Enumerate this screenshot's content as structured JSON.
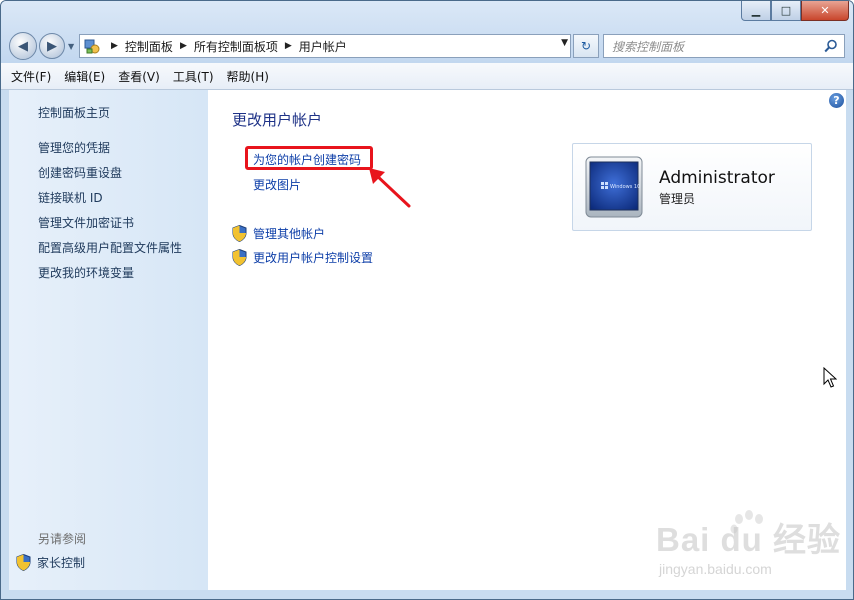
{
  "window": {
    "minimize": "▁",
    "maximize": "□",
    "close": "✕"
  },
  "nav": {
    "back_glyph": "◀",
    "forward_glyph": "▶",
    "recent_glyph": "▼"
  },
  "address": {
    "crumbs": [
      "控制面板",
      "所有控制面板项",
      "用户帐户"
    ],
    "drop_glyph": "▼",
    "refresh_glyph": "↻"
  },
  "search": {
    "placeholder": "搜索控制面板"
  },
  "menu": {
    "items": [
      "文件(F)",
      "编辑(E)",
      "查看(V)",
      "工具(T)",
      "帮助(H)"
    ]
  },
  "sidebar": {
    "home": "控制面板主页",
    "links": [
      "管理您的凭据",
      "创建密码重设盘",
      "链接联机 ID",
      "管理文件加密证书",
      "配置高级用户配置文件属性",
      "更改我的环境变量"
    ],
    "see_also": "另请参阅",
    "parental": "家长控制"
  },
  "main": {
    "help": "?",
    "title": "更改用户帐户",
    "create_password": "为您的帐户创建密码",
    "change_picture": "更改图片",
    "manage_other": "管理其他帐户",
    "uac_settings": "更改用户帐户控制设置"
  },
  "account": {
    "name": "Administrator",
    "role": "管理员",
    "pic_label": "Windows 10"
  },
  "watermark": {
    "text": "Bai du 经验",
    "sub": "jingyan.baidu.com"
  },
  "colors": {
    "link": "#0d3ea8",
    "title": "#1e3287",
    "highlight": "#e8141c"
  }
}
